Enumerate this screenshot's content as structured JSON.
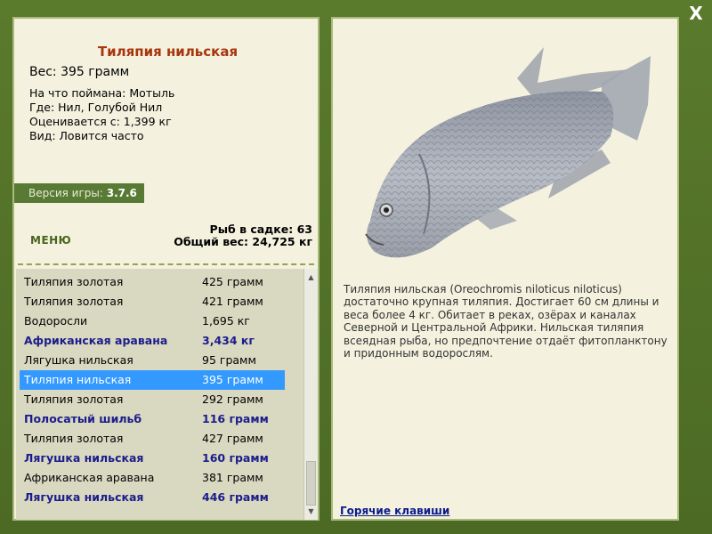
{
  "window": {
    "close_label": "X"
  },
  "fish": {
    "title": "Тиляпия нильская",
    "weight_label": "Вес: 395 грамм",
    "caught_on": "На что поймана: Мотыль",
    "location": "Где: Нил, Голубой Нил",
    "valued_from": "Оценивается с: 1,399 кг",
    "frequency": "Вид: Ловится часто",
    "description": "Тиляпия нильская (Oreochromis niloticus niloticus) достаточно крупная тиляпия. Достигает 60 см длины и веса более 4 кг. Обитает в реках, озёрах и каналах Северной и Центральной Африки. Нильская тиляпия всеядная рыба, но предпочтение отдаёт фитопланктону и придонным водорослям."
  },
  "version": {
    "label": "Версия игры:",
    "value": "3.7.6"
  },
  "menu": {
    "label": "МЕНЮ"
  },
  "cage": {
    "count_line": "Рыб в садке: 63",
    "total_weight_line": "Общий вес: 24,725 кг"
  },
  "fish_list": [
    {
      "name": "Тиляпия золотая",
      "weight": "425 грамм",
      "rare": false,
      "selected": false
    },
    {
      "name": "Тиляпия золотая",
      "weight": "421 грамм",
      "rare": false,
      "selected": false
    },
    {
      "name": "Водоросли",
      "weight": "1,695 кг",
      "rare": false,
      "selected": false
    },
    {
      "name": "Африканская аравана",
      "weight": "3,434 кг",
      "rare": true,
      "selected": false
    },
    {
      "name": "Лягушка нильская",
      "weight": "95 грамм",
      "rare": false,
      "selected": false
    },
    {
      "name": "Тиляпия нильская",
      "weight": "395 грамм",
      "rare": false,
      "selected": true
    },
    {
      "name": "Тиляпия золотая",
      "weight": "292 грамм",
      "rare": false,
      "selected": false
    },
    {
      "name": "Полосатый шильб",
      "weight": "116 грамм",
      "rare": true,
      "selected": false
    },
    {
      "name": "Тиляпия золотая",
      "weight": "427 грамм",
      "rare": false,
      "selected": false
    },
    {
      "name": "Лягушка нильская",
      "weight": "160 грамм",
      "rare": true,
      "selected": false
    },
    {
      "name": "Африканская аравана",
      "weight": "381 грамм",
      "rare": false,
      "selected": false
    },
    {
      "name": "Лягушка нильская",
      "weight": "446 грамм",
      "rare": true,
      "selected": false
    }
  ],
  "links": {
    "hotkeys": "Горячие клавиши"
  },
  "colors": {
    "frame": "#4f6e27",
    "panel": "#f4f2df",
    "title": "#a7350e",
    "rare": "#1c1d8c",
    "selected": "#3399ff"
  },
  "icons": {
    "close": "close-icon",
    "scroll_up": "arrow-up-icon",
    "scroll_down": "arrow-down-icon"
  }
}
